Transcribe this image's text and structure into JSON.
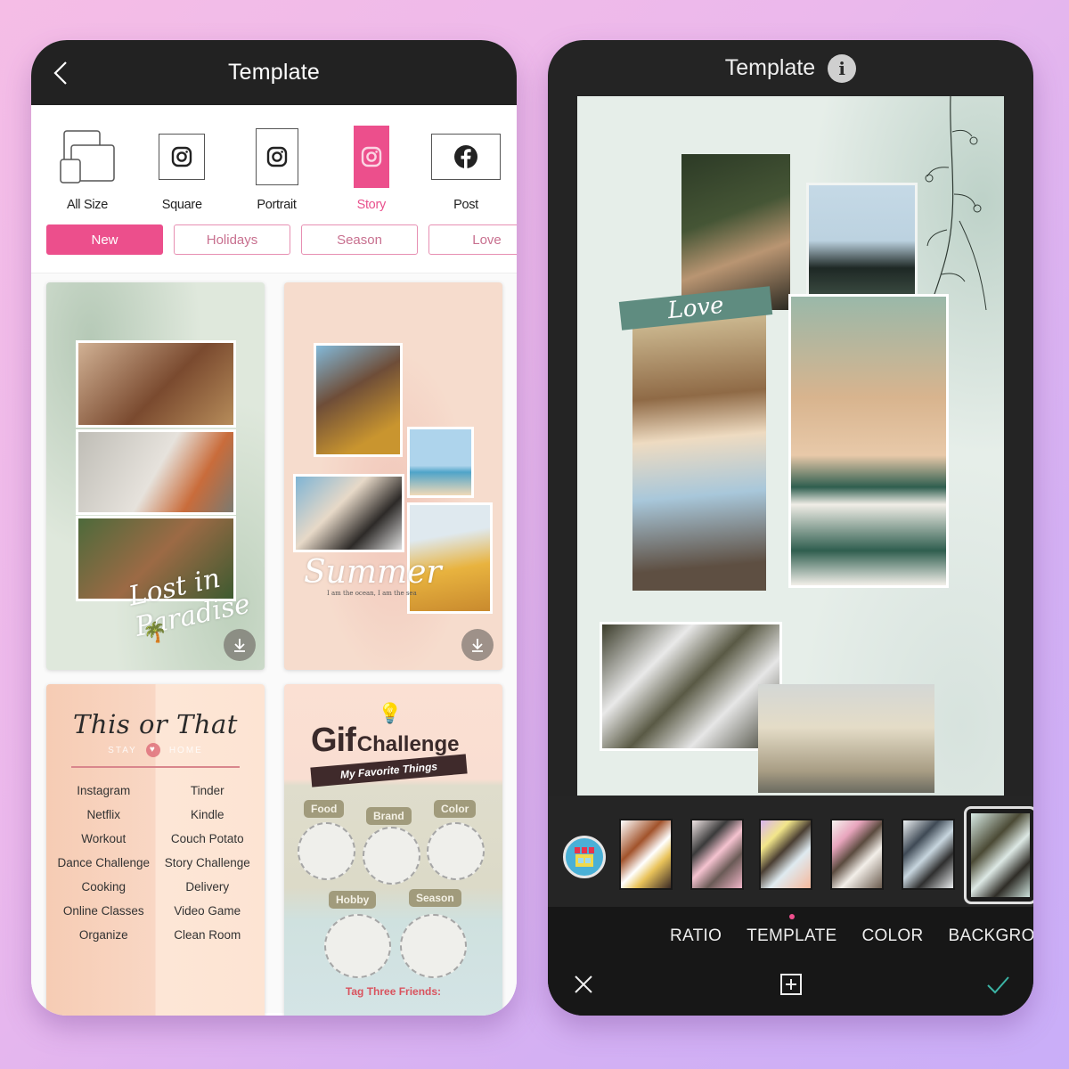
{
  "left": {
    "header": {
      "title": "Template",
      "back_icon": "chevron-left-icon"
    },
    "sizes": [
      {
        "label": "All Size",
        "icon": "devices-icon",
        "active": false
      },
      {
        "label": "Square",
        "icon": "instagram-icon",
        "active": false
      },
      {
        "label": "Portrait",
        "icon": "instagram-icon",
        "active": false
      },
      {
        "label": "Story",
        "icon": "instagram-icon",
        "active": true
      },
      {
        "label": "Post",
        "icon": "facebook-icon",
        "active": false
      }
    ],
    "categories": [
      {
        "label": "New",
        "active": true
      },
      {
        "label": "Holidays",
        "active": false
      },
      {
        "label": "Season",
        "active": false
      },
      {
        "label": "Love",
        "active": false
      }
    ],
    "templates": {
      "tropical": {
        "script": "Lost in Paradise"
      },
      "summer": {
        "script": "Summer",
        "tagline": "I am the ocean, I am the sea"
      },
      "this_or_that": {
        "title": "This or That",
        "sub_left": "STAY",
        "sub_heart": "♥",
        "sub_right": "HOME",
        "items": [
          "Instagram",
          "Tinder",
          "Netflix",
          "Kindle",
          "Workout",
          "Couch Potato",
          "Dance Challenge",
          "Story Challenge",
          "Cooking",
          "Delivery",
          "Online Classes",
          "Video Game",
          "Organize",
          "Clean Room"
        ]
      },
      "gif_challenge": {
        "title_big": "Gif",
        "title_small": "Challenge",
        "banner": "My Favorite Things",
        "tags": [
          "Food",
          "Brand",
          "Color",
          "Hobby",
          "Season"
        ],
        "footer": "Tag Three Friends:"
      }
    }
  },
  "right": {
    "header": {
      "title": "Template",
      "info_icon": "i"
    },
    "canvas": {
      "tape_text": "Love"
    },
    "thumbnails_count": 6,
    "selected_thumbnail": 6,
    "tabs": [
      {
        "label": "RATIO",
        "active": false
      },
      {
        "label": "TEMPLATE",
        "active": true
      },
      {
        "label": "COLOR",
        "active": false
      },
      {
        "label": "BACKGRO",
        "active": false
      }
    ],
    "accent_color": "#f0508e",
    "confirm_color": "#3bb3a4"
  }
}
